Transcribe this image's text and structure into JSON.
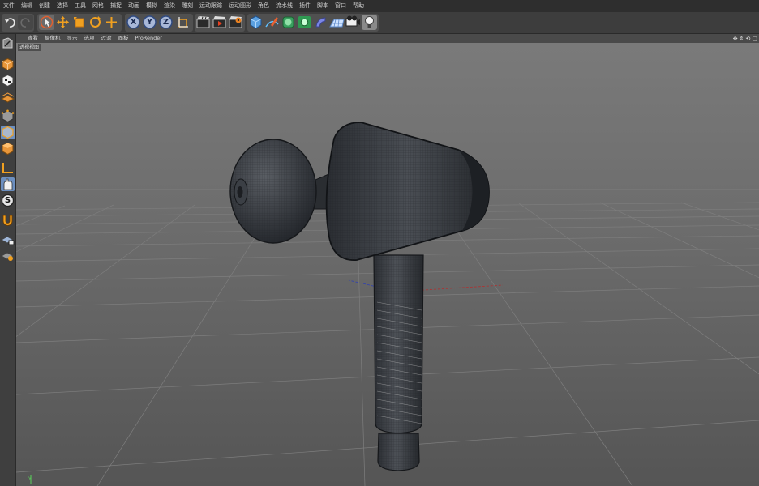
{
  "menu": {
    "items": [
      "文件",
      "编辑",
      "创建",
      "选择",
      "工具",
      "网格",
      "捕捉",
      "动画",
      "模拟",
      "渲染",
      "雕刻",
      "运动跟踪",
      "运动图形",
      "角色",
      "流水线",
      "插件",
      "脚本",
      "窗口",
      "帮助"
    ]
  },
  "toolbar": {
    "axis_x": "X",
    "axis_y": "Y",
    "axis_z": "Z"
  },
  "viewport": {
    "tabs": [
      "查看",
      "摄像机",
      "显示",
      "选项",
      "过滤",
      "面板",
      "ProRender"
    ],
    "controls": [
      "✥",
      "⇕",
      "⟲",
      "▢"
    ],
    "camera_label": "透视视图"
  },
  "sidebar": {
    "s_icon_label": "S"
  },
  "colors": {
    "menubar_bg": "#2e2e2e",
    "toolbar_bg": "#3d3d3d",
    "viewport_header_bg": "#4a4a4a",
    "viewport_bg": "#6b6b6b",
    "accent_orange": "#f0a020",
    "accent_blue": "#8fb4e6"
  }
}
